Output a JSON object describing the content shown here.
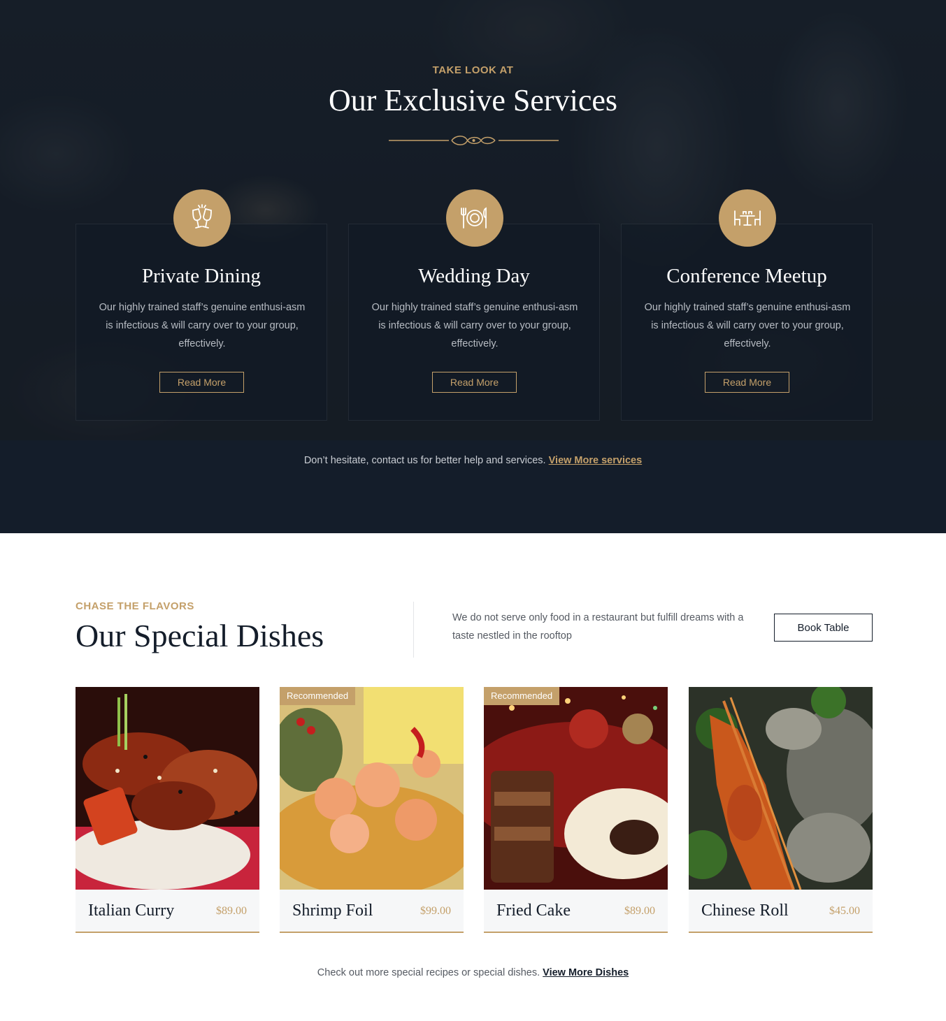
{
  "services": {
    "eyebrow": "TAKE LOOK AT",
    "title": "Our Exclusive Services",
    "cards": [
      {
        "icon": "champagne-glasses-icon",
        "title": "Private Dining",
        "description": "Our highly trained staff’s genuine enthusi-asm is infectious & will carry over to your group, effectively.",
        "button": "Read More"
      },
      {
        "icon": "plate-cutlery-icon",
        "title": "Wedding Day",
        "description": "Our highly trained staff’s genuine enthusi-asm is infectious & will carry over to your group, effectively.",
        "button": "Read More"
      },
      {
        "icon": "dining-table-icon",
        "title": "Conference Meetup",
        "description": "Our highly trained staff’s genuine enthusi-asm is infectious & will carry over to your group, effectively.",
        "button": "Read More"
      }
    ],
    "footer_text": "Don’t hesitate, contact us for better help and services.",
    "footer_link": "View More services"
  },
  "dishes": {
    "eyebrow": "CHASE THE FLAVORS",
    "title": "Our Special Dishes",
    "intro": "We do not serve only food in a restaurant but fulfill dreams with a taste nestled in the rooftop",
    "book_button": "Book Table",
    "items": [
      {
        "name": "Italian Curry",
        "price": "$89.00",
        "badge": ""
      },
      {
        "name": "Shrimp Foil",
        "price": "$99.00",
        "badge": "Recommended"
      },
      {
        "name": "Fried Cake",
        "price": "$89.00",
        "badge": "Recommended"
      },
      {
        "name": "Chinese Roll",
        "price": "$45.00",
        "badge": ""
      }
    ],
    "footer_text": "Check out more special recipes or special dishes.",
    "footer_link": "View More Dishes"
  },
  "colors": {
    "accent": "#c4a06a",
    "dark": "#141d2a"
  }
}
